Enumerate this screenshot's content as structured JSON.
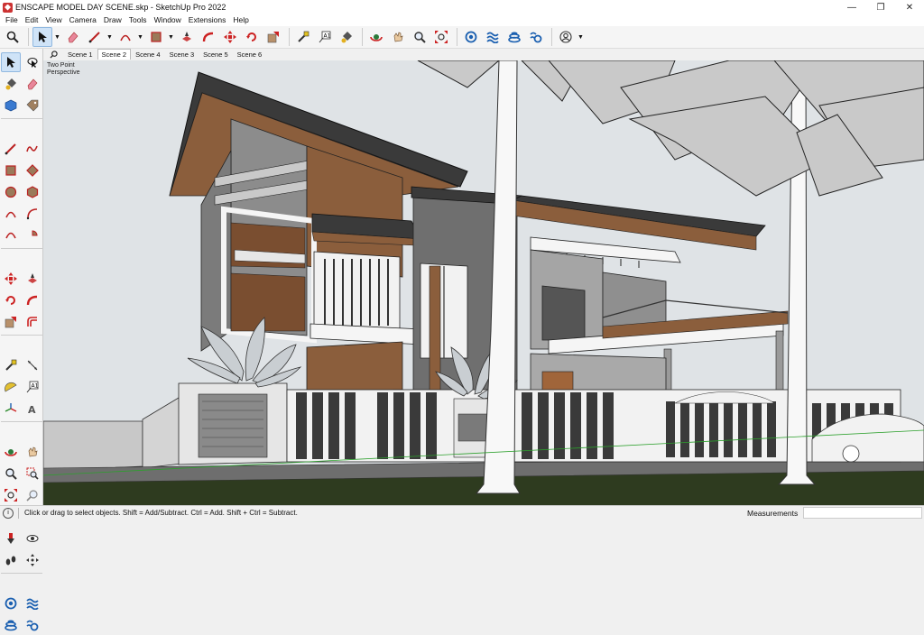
{
  "window": {
    "title": "ENSCAPE MODEL DAY SCENE.skp - SketchUp Pro 2022",
    "minimize_glyph": "—",
    "maximize_glyph": "❐",
    "close_glyph": "✕"
  },
  "menu": [
    "File",
    "Edit",
    "View",
    "Camera",
    "Draw",
    "Tools",
    "Window",
    "Extensions",
    "Help"
  ],
  "toolbar": {
    "icons": [
      "zoom-icon",
      "select-icon",
      "eraser-icon",
      "line-icon",
      "arc-icon",
      "rectangle-icon",
      "push-pull-icon",
      "follow-me-icon",
      "move-icon",
      "rotate-icon",
      "scale-icon",
      "tape-measure-icon",
      "text-icon",
      "paint-bucket-icon",
      "orbit-icon",
      "pan-icon",
      "zoom-tool-icon",
      "zoom-extents-icon",
      "enscape-icon",
      "layers-icon",
      "styles-icon",
      "settings-icon",
      "account-icon"
    ]
  },
  "scenes": {
    "tabs": [
      "Scene 1",
      "Scene 2",
      "Scene 4",
      "Scene 3",
      "Scene 5",
      "Scene 6"
    ],
    "selected": "Scene 2"
  },
  "viewport": {
    "perspective_label_line1": "Two Point",
    "perspective_label_line2": "Perspective"
  },
  "status": {
    "hint": "Click or drag to select objects. Shift = Add/Subtract. Ctrl = Add. Shift + Ctrl = Subtract.",
    "measurements_label": "Measurements",
    "measurements_value": ""
  },
  "colors": {
    "sky": "#dfe3e6",
    "ground": "#2e3b1f",
    "wood": "#8b5e3c",
    "roof": "#3a3a3a",
    "wall_grey": "#9a9a9a",
    "selection_blue": "#cfe3f7"
  }
}
